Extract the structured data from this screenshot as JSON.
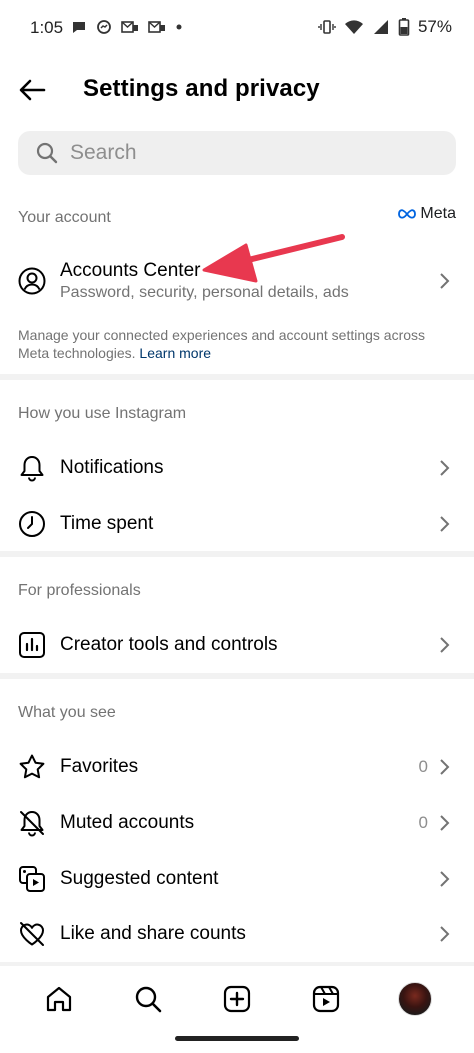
{
  "status_bar": {
    "time": "1:05",
    "battery": "57%",
    "icons_left": [
      "chat-bubble-icon",
      "messenger-icon",
      "whatsapp-icon",
      "mail-icon",
      "dot-icon"
    ],
    "icons_right": [
      "vibrate-icon",
      "wifi-icon",
      "signal-icon",
      "battery-icon"
    ]
  },
  "header": {
    "title": "Settings and privacy",
    "back_icon": "back-arrow-icon"
  },
  "search": {
    "placeholder": "Search"
  },
  "your_account": {
    "label": "Your account",
    "meta_label": "Meta",
    "accounts_center": {
      "title": "Accounts Center",
      "subtitle": "Password, security, personal details, ads"
    },
    "description": "Manage your connected experiences and account settings across Meta technologies.",
    "learn_more": "Learn more"
  },
  "how_you_use": {
    "label": "How you use Instagram",
    "items": [
      {
        "label": "Notifications",
        "icon": "bell-icon"
      },
      {
        "label": "Time spent",
        "icon": "clock-icon"
      }
    ]
  },
  "for_professionals": {
    "label": "For professionals",
    "items": [
      {
        "label": "Creator tools and controls",
        "icon": "bar-chart-icon"
      }
    ]
  },
  "what_you_see": {
    "label": "What you see",
    "items": [
      {
        "label": "Favorites",
        "icon": "star-icon",
        "count": "0"
      },
      {
        "label": "Muted accounts",
        "icon": "muted-bell-icon",
        "count": "0"
      },
      {
        "label": "Suggested content",
        "icon": "suggested-content-icon"
      },
      {
        "label": "Like and share counts",
        "icon": "heart-slash-icon"
      }
    ]
  },
  "annotation": {
    "arrow_color": "#e8384f"
  },
  "bottom_nav": {
    "items": [
      "home-icon",
      "search-icon",
      "create-icon",
      "reels-icon",
      "profile-avatar"
    ]
  }
}
